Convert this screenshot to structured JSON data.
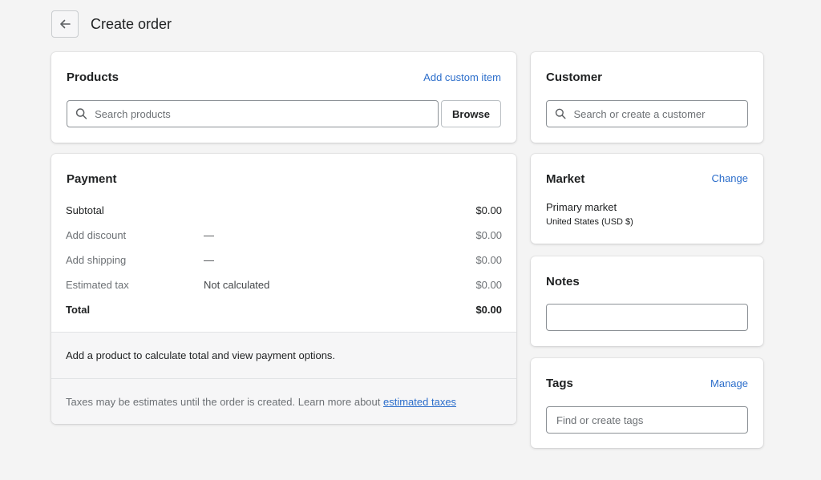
{
  "header": {
    "title": "Create order",
    "back_icon": "arrow-left-icon"
  },
  "products": {
    "title": "Products",
    "add_custom_item": "Add custom item",
    "search_placeholder": "Search products",
    "browse": "Browse"
  },
  "payment": {
    "title": "Payment",
    "rows": [
      {
        "label": "Subtotal",
        "detail": "",
        "amount": "$0.00"
      },
      {
        "label": "Add discount",
        "detail": "—",
        "amount": "$0.00"
      },
      {
        "label": "Add shipping",
        "detail": "—",
        "amount": "$0.00"
      },
      {
        "label": "Estimated tax",
        "detail": "Not calculated",
        "amount": "$0.00"
      },
      {
        "label": "Total",
        "detail": "",
        "amount": "$0.00"
      }
    ],
    "message": "Add a product to calculate total and view payment options.",
    "tax_note": "Taxes may be estimates until the order is created. Learn more about",
    "tax_link": "estimated taxes"
  },
  "customer": {
    "title": "Customer",
    "search_placeholder": "Search or create a customer"
  },
  "market": {
    "title": "Market",
    "change": "Change",
    "name": "Primary market",
    "region": "United States (USD $)"
  },
  "notes": {
    "title": "Notes",
    "value": ""
  },
  "tags": {
    "title": "Tags",
    "manage": "Manage",
    "placeholder": "Find or create tags"
  },
  "colors": {
    "background": "#f4f4f4",
    "link": "#2c6ecb",
    "text": "#202223",
    "muted": "#6d7175"
  }
}
